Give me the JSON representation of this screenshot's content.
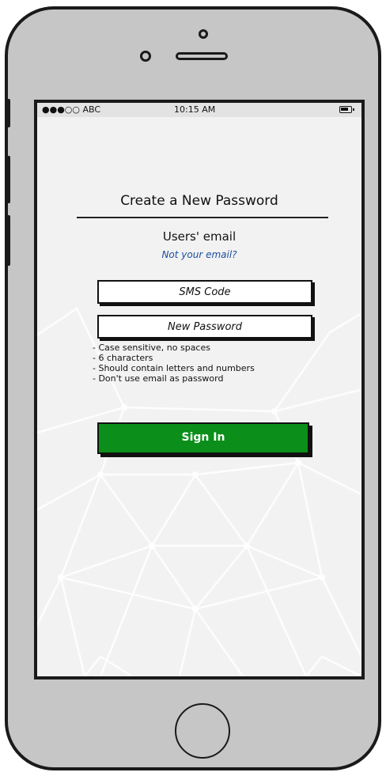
{
  "status_bar": {
    "carrier": "●●●○○ ABC",
    "time": "10:15 AM",
    "battery_icon": "battery-icon"
  },
  "form": {
    "title": "Create a New Password",
    "email": "Users' email",
    "not_your_email": "Not your email?",
    "sms_placeholder": "SMS Code",
    "sms_value": "",
    "password_placeholder": "New Password",
    "password_value": "",
    "rules": [
      "- Case sensitive, no spaces",
      "- 6 characters",
      "- Should contain letters and numbers",
      "- Don't use email as password"
    ],
    "sign_in_label": "Sign In"
  },
  "colors": {
    "primary_button": "#0b8f1a",
    "link": "#1a4fa0",
    "phone_body": "#c6c6c6"
  }
}
